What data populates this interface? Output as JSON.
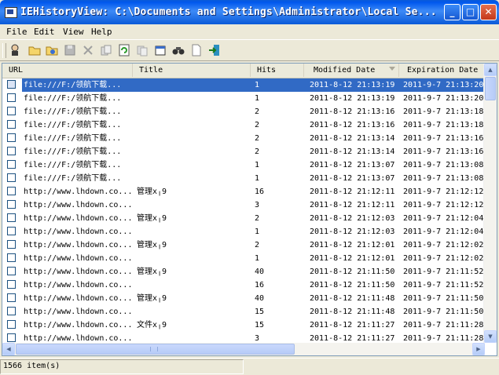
{
  "window": {
    "title": "IEHistoryView:  C:\\Documents and Settings\\Administrator\\Local Se...",
    "minimize": "_",
    "maximize": "□",
    "close": "✕"
  },
  "menu": [
    "File",
    "Edit",
    "View",
    "Help"
  ],
  "toolbar_icons": [
    "select-computer-icon",
    "open-folder-icon",
    "favorites-icon",
    "save-icon",
    "delete-icon",
    "copy-icon",
    "refresh-icon",
    "copy-html-icon",
    "properties-icon",
    "find-icon",
    "blank-page-icon",
    "exit-icon"
  ],
  "columns": [
    "URL",
    "Title",
    "Hits",
    "Modified Date",
    "Expiration Date"
  ],
  "rows": [
    {
      "url": "file:///F:/领航下载...",
      "title": "",
      "hits": "1",
      "modified": "2011-8-12 21:13:19",
      "expires": "2011-9-7 21:13:20",
      "selected": true
    },
    {
      "url": "file:///F:/领航下载...",
      "title": "",
      "hits": "1",
      "modified": "2011-8-12 21:13:19",
      "expires": "2011-9-7 21:13:20"
    },
    {
      "url": "file:///F:/领航下载...",
      "title": "",
      "hits": "2",
      "modified": "2011-8-12 21:13:16",
      "expires": "2011-9-7 21:13:18"
    },
    {
      "url": "file:///F:/领航下载...",
      "title": "",
      "hits": "2",
      "modified": "2011-8-12 21:13:16",
      "expires": "2011-9-7 21:13:18"
    },
    {
      "url": "file:///F:/领航下载...",
      "title": "",
      "hits": "2",
      "modified": "2011-8-12 21:13:14",
      "expires": "2011-9-7 21:13:16"
    },
    {
      "url": "file:///F:/领航下载...",
      "title": "",
      "hits": "2",
      "modified": "2011-8-12 21:13:14",
      "expires": "2011-9-7 21:13:16"
    },
    {
      "url": "file:///F:/领航下载...",
      "title": "",
      "hits": "1",
      "modified": "2011-8-12 21:13:07",
      "expires": "2011-9-7 21:13:08"
    },
    {
      "url": "file:///F:/领航下载...",
      "title": "",
      "hits": "1",
      "modified": "2011-8-12 21:13:07",
      "expires": "2011-9-7 21:13:08"
    },
    {
      "url": "http://www.lhdown.co...",
      "title": "管理x╷9",
      "hits": "16",
      "modified": "2011-8-12 21:12:11",
      "expires": "2011-9-7 21:12:12"
    },
    {
      "url": "http://www.lhdown.co...",
      "title": "",
      "hits": "3",
      "modified": "2011-8-12 21:12:11",
      "expires": "2011-9-7 21:12:12"
    },
    {
      "url": "http://www.lhdown.co...",
      "title": "管理x╷9",
      "hits": "2",
      "modified": "2011-8-12 21:12:03",
      "expires": "2011-9-7 21:12:04"
    },
    {
      "url": "http://www.lhdown.co...",
      "title": "",
      "hits": "1",
      "modified": "2011-8-12 21:12:03",
      "expires": "2011-9-7 21:12:04"
    },
    {
      "url": "http://www.lhdown.co...",
      "title": "管理x╷9",
      "hits": "2",
      "modified": "2011-8-12 21:12:01",
      "expires": "2011-9-7 21:12:02"
    },
    {
      "url": "http://www.lhdown.co...",
      "title": "",
      "hits": "1",
      "modified": "2011-8-12 21:12:01",
      "expires": "2011-9-7 21:12:02"
    },
    {
      "url": "http://www.lhdown.co...",
      "title": "管理x╷9",
      "hits": "40",
      "modified": "2011-8-12 21:11:50",
      "expires": "2011-9-7 21:11:52"
    },
    {
      "url": "http://www.lhdown.co...",
      "title": "",
      "hits": "16",
      "modified": "2011-8-12 21:11:50",
      "expires": "2011-9-7 21:11:52"
    },
    {
      "url": "http://www.lhdown.co...",
      "title": "管理x╷9",
      "hits": "40",
      "modified": "2011-8-12 21:11:48",
      "expires": "2011-9-7 21:11:50"
    },
    {
      "url": "http://www.lhdown.co...",
      "title": "",
      "hits": "15",
      "modified": "2011-8-12 21:11:48",
      "expires": "2011-9-7 21:11:50"
    },
    {
      "url": "http://www.lhdown.co...",
      "title": "文件x╷9",
      "hits": "15",
      "modified": "2011-8-12 21:11:27",
      "expires": "2011-9-7 21:11:28"
    },
    {
      "url": "http://www.lhdown.co...",
      "title": "",
      "hits": "3",
      "modified": "2011-8-12 21:11:27",
      "expires": "2011-9-7 21:11:28"
    }
  ],
  "status": "1566 item(s)"
}
